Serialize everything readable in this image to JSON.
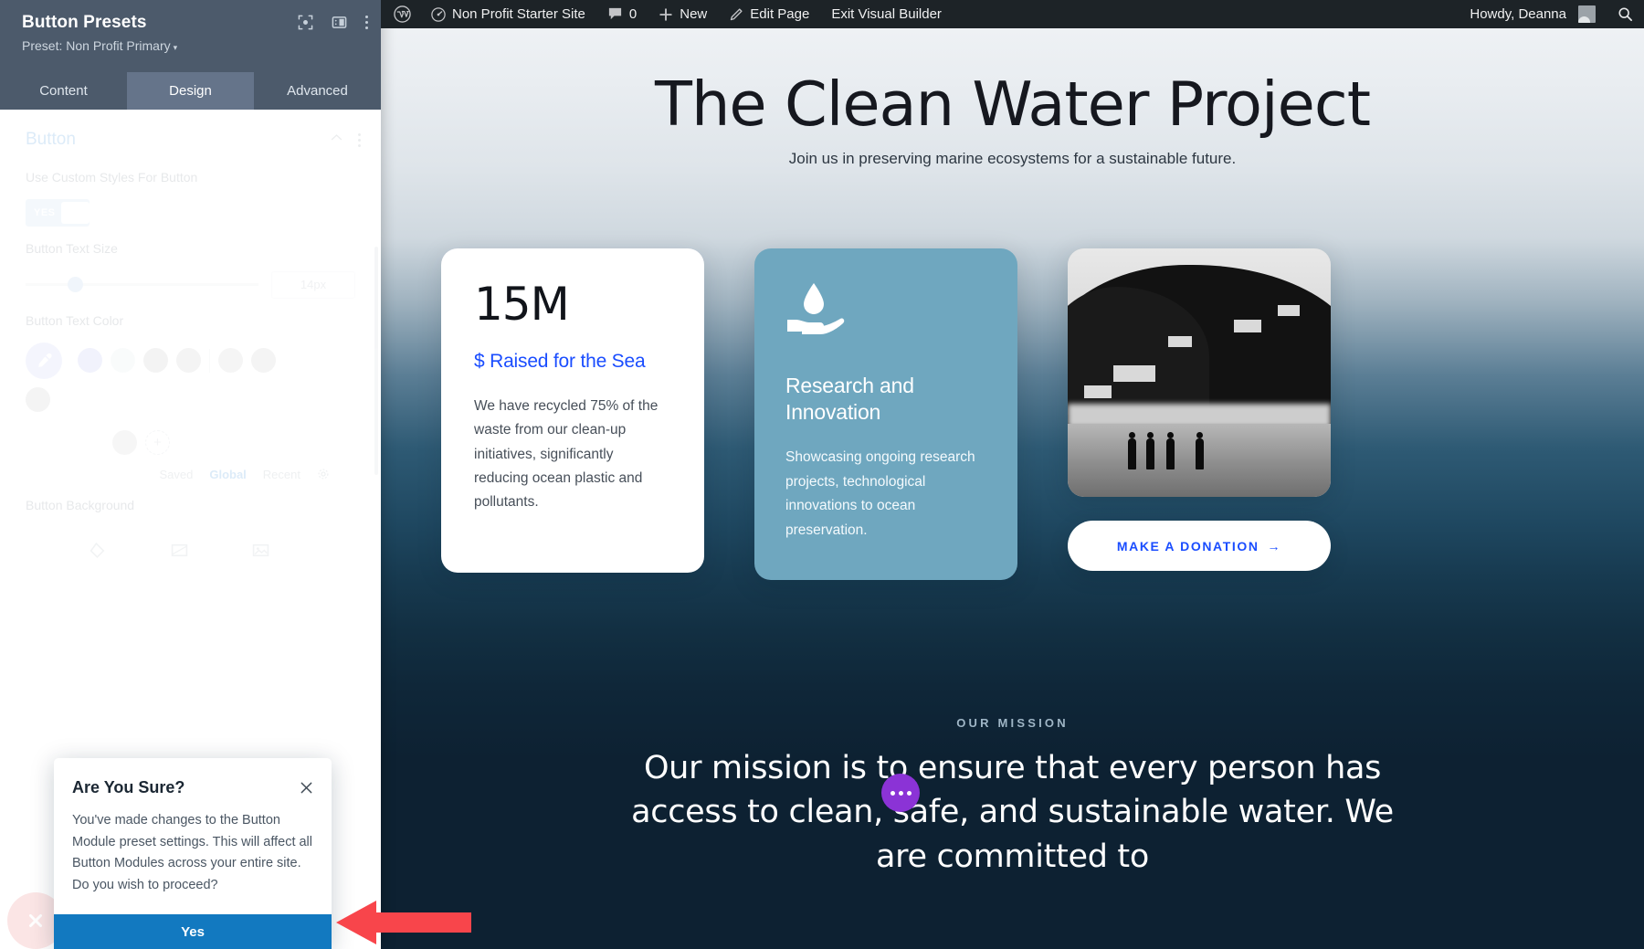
{
  "adminbar": {
    "logo_icon": "wordpress-logo-icon",
    "site_icon": "dashboard-icon",
    "site_name": "Non Profit Starter Site",
    "comments_icon": "comment-bubble-icon",
    "comments_count": "0",
    "new_icon": "plus-icon",
    "new_label": "New",
    "edit_icon": "pencil-icon",
    "edit_label": "Edit Page",
    "exit_label": "Exit Visual Builder",
    "howdy": "Howdy, Deanna",
    "avatar_icon": "user-avatar-icon",
    "search_icon": "search-icon"
  },
  "panel": {
    "title": "Button Presets",
    "preset_label": "Preset: Non Profit Primary",
    "preset_caret": "▾",
    "icons": {
      "focus": "focus-target-icon",
      "layout": "panel-layout-icon",
      "more": "more-vertical-icon"
    },
    "tabs": [
      {
        "label": "Content",
        "active": false
      },
      {
        "label": "Design",
        "active": true
      },
      {
        "label": "Advanced",
        "active": false
      }
    ],
    "section": {
      "heading": "Button",
      "collapse_icon": "chevron-up-icon",
      "more_icon": "more-vertical-icon"
    },
    "fields": {
      "custom_styles_label": "Use Custom Styles For Button",
      "toggle_value": "YES",
      "text_size_label": "Button Text Size",
      "text_size_value": "14px",
      "text_color_label": "Button Text Color",
      "eyedropper_icon": "eyedropper-icon",
      "add_swatch_icon": "plus-circle-icon",
      "palette_tabs": [
        "Saved",
        "Global",
        "Recent"
      ],
      "palette_active": "Global",
      "palette_gear_icon": "gear-icon",
      "background_label": "Button Background",
      "background_tabs": [
        "color-fill-icon",
        "gradient-icon",
        "image-icon"
      ]
    },
    "close_icon": "close-circle-icon"
  },
  "modal": {
    "title": "Are You Sure?",
    "close_icon": "close-icon",
    "body": "You've made changes to the Button Module preset settings. This will affect all Button Modules across your entire site. Do you wish to proceed?",
    "confirm_label": "Yes"
  },
  "annotation": {
    "arrow_icon": "left-arrow-annotation",
    "color": "#f8454b"
  },
  "page": {
    "hero_title": "The Clean Water Project",
    "hero_subtitle": "Join us in preserving marine ecosystems for a sustainable future.",
    "cards": [
      {
        "type": "stat",
        "number": "15M",
        "label": "$ Raised for the Sea",
        "body": "We have recycled 75% of the waste from our clean-up initiatives, significantly reducing ocean plastic and pollutants."
      },
      {
        "type": "feature",
        "icon": "hand-holding-water-drop-icon",
        "heading": "Research and Innovation",
        "body": "Showcasing ongoing research projects, technological innovations to ocean preservation."
      },
      {
        "type": "media",
        "image_alt": "black-and-white-photo-of-people-on-beach",
        "button_label": "MAKE A DONATION",
        "button_arrow": "→"
      }
    ],
    "mission_eyebrow": "OUR MISSION",
    "mission_text": "Our mission is to ensure that every person has access to clean, safe, and sustainable water. We are committed to",
    "fab_icon": "ellipsis-icon"
  },
  "colors": {
    "accent_blue": "#1a4dff",
    "card_blue": "#6fa7bf",
    "panel_header": "#4c5a6b",
    "confirm_blue": "#1279c0",
    "arrow_red": "#f8454b",
    "fab_purple": "#8b33d6",
    "ocean_dark": "#0d2132"
  }
}
